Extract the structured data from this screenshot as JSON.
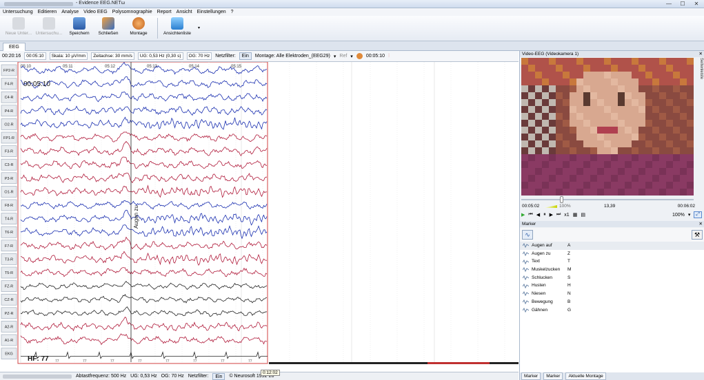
{
  "window": {
    "title": "- Evidence EEG.NETω",
    "controls": [
      "—",
      "☐",
      "✕"
    ]
  },
  "menu": [
    "Untersuchung",
    "Editieren",
    "Analyse",
    "Video EEG",
    "Polysomnographie",
    "Report",
    "Ansicht",
    "Einstellungen",
    "?"
  ],
  "ribbon": {
    "new": "Neue Unter...",
    "exam": "Untersuchu...",
    "save": "Speichern",
    "close": "Schließen",
    "montage": "Montage",
    "views": "Ansichtenliste"
  },
  "tabs": {
    "eeg": "EEG"
  },
  "toolbar": {
    "time": "00:20:16",
    "position": "00:05:10",
    "scale": "Skala: 10 µV/mm",
    "timebase": "Zeitachse: 30 mm/s",
    "lowcut": "UG: 0,53 Hz (0,30 s)",
    "highcut": "OG: 70 Hz",
    "notch_label": "Netzfilter:",
    "notch_btn": "Ein",
    "montage": "Montage: Alle Elektroden_(EEG29)",
    "ref": "Ref",
    "clock": "00:05:10"
  },
  "eeg": {
    "channels": [
      "FP2-R",
      "F4-R",
      "C4-R",
      "P4-R",
      "O2-R",
      "FP1-R",
      "F3-R",
      "C3-R",
      "P3-R",
      "O1-R",
      "F8-R",
      "T4-R",
      "T6-R",
      "F7-R",
      "T3-R",
      "T5-R",
      "FZ-R",
      "CZ-R",
      "PZ-R",
      "A2-R",
      "A1-R",
      "EKG"
    ],
    "channel_colors": [
      "blue",
      "blue",
      "blue",
      "blue",
      "blue",
      "red",
      "red",
      "red",
      "red",
      "red",
      "blue",
      "blue",
      "blue",
      "red",
      "red",
      "red",
      "black",
      "black",
      "black",
      "red",
      "red",
      "black"
    ],
    "time_ticks": [
      "05:10",
      "05:11",
      "05:12",
      "05:13",
      "05:14",
      "05:15"
    ],
    "overlay_time": "00:05:10",
    "event_label": "Augen zu",
    "hr_label": "HF: 77",
    "hr_beats": [
      "77",
      "77",
      "77",
      "77",
      "77",
      "77",
      "77",
      "77"
    ]
  },
  "status": {
    "sampling": "Abtastfrequenz: 500 Hz",
    "lowcut": "UG: 0,53 Hz",
    "highcut": "OG: 70 Hz",
    "notch_label": "Netzfilter:",
    "notch_btn": "Ein",
    "copyright": "© Neurosoft 1992-20",
    "tooltip": "0:12:02"
  },
  "video": {
    "header": "Video-EEG (Videokamera 1)",
    "side_tab": "Seitenleiste",
    "time_start": "00:05:02",
    "volume": "100%",
    "fps": "13,39",
    "time_end": "00:06:02",
    "speed": "x1",
    "zoom": "100%"
  },
  "marker": {
    "header": "Marker",
    "items": [
      {
        "name": "Augen auf",
        "key": "A"
      },
      {
        "name": "Augen zu",
        "key": "Z"
      },
      {
        "name": "Text",
        "key": "T"
      },
      {
        "name": "Muskelzucken",
        "key": "M"
      },
      {
        "name": "Schlucken",
        "key": "S"
      },
      {
        "name": "Husten",
        "key": "H"
      },
      {
        "name": "Niesen",
        "key": "N"
      },
      {
        "name": "Bewegung",
        "key": "B"
      },
      {
        "name": "Gähnen",
        "key": "G"
      }
    ],
    "tabs": [
      "Marker",
      "Marker",
      "Aktuelle Montage"
    ]
  },
  "colors": {
    "accent": "#2b5aa6",
    "trace_blue": "#1a2fb0",
    "trace_red": "#b01a3a",
    "trace_black": "#222222"
  }
}
